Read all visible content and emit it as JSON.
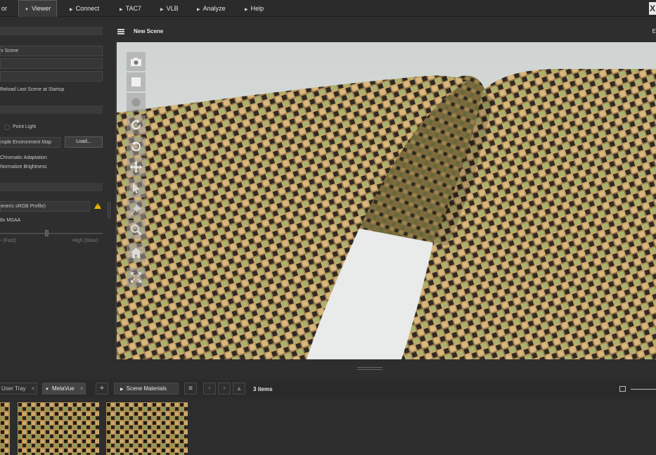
{
  "menu": {
    "items": [
      {
        "label": "or",
        "has_arrow": false
      },
      {
        "label": "Viewer",
        "has_arrow": true,
        "active": true
      },
      {
        "label": "Connect",
        "has_arrow": true
      },
      {
        "label": "TAC7",
        "has_arrow": true
      },
      {
        "label": "VLB",
        "has_arrow": true
      },
      {
        "label": "Analyze",
        "has_arrow": true
      },
      {
        "label": "Help",
        "has_arrow": true
      }
    ],
    "close_label": "X"
  },
  "left_panel": {
    "scene_field": "v Scene",
    "reload_label": "Reload Last Scene at Startup",
    "point_light_label": "Point Light",
    "env_map_field": "mple Environment Map",
    "load_button": "Load...",
    "chromatic_label": "Chromatic Adaptation",
    "normalize_label": "Normalize Brightness",
    "profile_field": "eneric sRGB Profile)",
    "msaa_label": "8x MSAA",
    "quality_low": "- (Fast)",
    "quality_high": "High (Slow)"
  },
  "viewport": {
    "title": "New Scene",
    "edge_label": "E",
    "tools": [
      "camera-icon",
      "square-icon",
      "circle-icon",
      "rotate-icon",
      "orbit-icon",
      "move-icon",
      "pointer-icon",
      "pin-icon",
      "zoom-icon",
      "home-icon",
      "fit-icon"
    ]
  },
  "tray": {
    "tabs": [
      {
        "label": "User Tray",
        "close": "×"
      },
      {
        "label": "MetaVue",
        "close": "×",
        "active": true
      }
    ],
    "add_label": "+",
    "scene_materials_label": "Scene Materials",
    "items_count": "3 items"
  },
  "colors": {
    "fabric_tan": "#c9a46a",
    "fabric_dark": "#2f2a22",
    "fabric_green": "#9aa86a",
    "warning": "#e8b400"
  }
}
